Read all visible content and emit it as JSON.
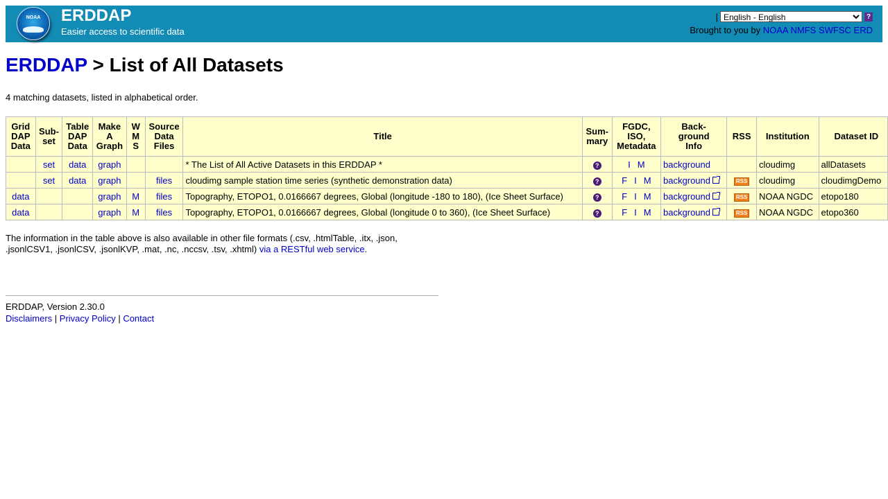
{
  "header": {
    "brand_title": "ERDDAP",
    "brand_subtitle": "Easier access to scientific data",
    "logo_text": "NOAA",
    "separator": "|",
    "language_selected": "English - English",
    "help_icon": "?",
    "brought_prefix": "Brought to you by",
    "org_links": [
      "NOAA",
      "NMFS",
      "SWFSC",
      "ERD"
    ]
  },
  "breadcrumb": {
    "root": "ERDDAP",
    "separator": " > ",
    "page": "List of All Datasets"
  },
  "match_text": "4 matching datasets, listed in alphabetical order.",
  "table": {
    "headers": {
      "griddap": "Grid DAP Data",
      "subset": "Sub- set",
      "tabledap": "Table DAP Data",
      "graph": "Make A Graph",
      "wms": "W M S",
      "files": "Source Data Files",
      "title": "Title",
      "summary": "Sum- mary",
      "metadata": "FGDC, ISO, Metadata",
      "background": "Back- ground Info",
      "rss": "RSS",
      "institution": "Institution",
      "dataset_id": "Dataset ID"
    },
    "rows": [
      {
        "griddap": "",
        "subset": "set",
        "tabledap": "data",
        "graph": "graph",
        "wms": "",
        "files": "",
        "title": "* The List of All Active Datasets in this ERDDAP *",
        "summary": "?",
        "fgdc": "",
        "iso": "I",
        "meta": "M",
        "background": "background",
        "background_ext": false,
        "rss": "",
        "institution": "cloudimg",
        "dataset_id": "allDatasets"
      },
      {
        "griddap": "",
        "subset": "set",
        "tabledap": "data",
        "graph": "graph",
        "wms": "",
        "files": "files",
        "title": "cloudimg sample station time series (synthetic demonstration data)",
        "summary": "?",
        "fgdc": "F",
        "iso": "I",
        "meta": "M",
        "background": "background",
        "background_ext": true,
        "rss": "RSS",
        "institution": "cloudimg",
        "dataset_id": "cloudimgDemo"
      },
      {
        "griddap": "data",
        "subset": "",
        "tabledap": "",
        "graph": "graph",
        "wms": "M",
        "files": "files",
        "title": "Topography, ETOPO1, 0.0166667 degrees, Global (longitude -180 to 180), (Ice Sheet Surface)",
        "summary": "?",
        "fgdc": "F",
        "iso": "I",
        "meta": "M",
        "background": "background",
        "background_ext": true,
        "rss": "RSS",
        "institution": "NOAA NGDC",
        "dataset_id": "etopo180"
      },
      {
        "griddap": "data",
        "subset": "",
        "tabledap": "",
        "graph": "graph",
        "wms": "M",
        "files": "files",
        "title": "Topography, ETOPO1, 0.0166667 degrees, Global (longitude 0 to 360), (Ice Sheet Surface)",
        "summary": "?",
        "fgdc": "F",
        "iso": "I",
        "meta": "M",
        "background": "background",
        "background_ext": true,
        "rss": "RSS",
        "institution": "NOAA NGDC",
        "dataset_id": "etopo360"
      }
    ]
  },
  "info": {
    "text": "The information in the table above is also available in other file formats (.csv, .htmlTable, .itx, .json, .jsonlCSV1, .jsonlCSV, .jsonlKVP, .mat, .nc, .nccsv, .tsv, .xhtml)",
    "link": "via a RESTful web service",
    "end": "."
  },
  "footer": {
    "version": "ERDDAP, Version 2.30.0",
    "links": [
      "Disclaimers",
      "Privacy Policy",
      "Contact"
    ],
    "separator": " | "
  },
  "colors": {
    "banner": "#128cb5",
    "link": "#0000cc",
    "table_bg": "#ffffcc",
    "rss": "#f07f1a"
  }
}
